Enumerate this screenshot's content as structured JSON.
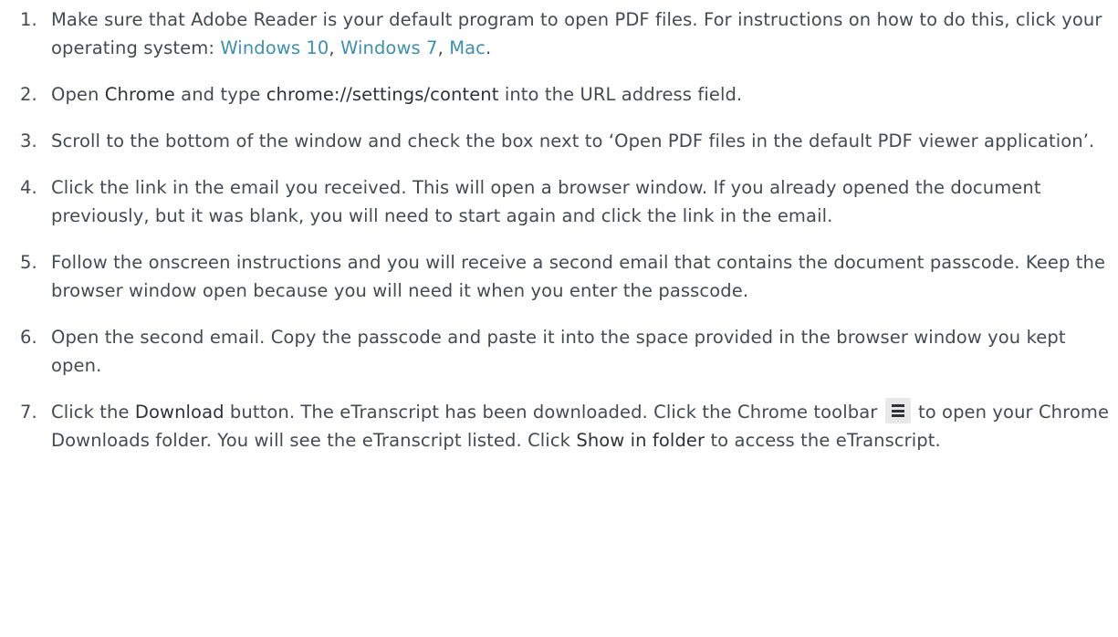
{
  "steps": [
    {
      "number": "1.",
      "t1": "Make sure that Adobe Reader is your default program to open PDF files. For instructions on how to do this, click your operating system: ",
      "link_win10": "Windows 10",
      "sep1": ", ",
      "link_win7": "Windows 7",
      "sep2": ", ",
      "link_mac": "Mac",
      "end": "."
    },
    {
      "number": "2.",
      "t1": "Open ",
      "b1": "Chrome",
      "t2": " and type ",
      "b2": "chrome://settings/content",
      "t3": " into the URL address field."
    },
    {
      "number": "3.",
      "text": "Scroll to the bottom of the window and check the box next to ‘Open PDF files in the default PDF viewer application’."
    },
    {
      "number": "4.",
      "text": "Click the link in the email you received. This will open a browser window. If you already opened the document previously, but it was blank, you will need to start again and click the link in the email."
    },
    {
      "number": "5.",
      "text": "Follow the onscreen instructions and you will receive a second email that contains the document passcode. Keep the browser window open because you will need it when you enter the passcode."
    },
    {
      "number": "6.",
      "text": "Open the second email. Copy the passcode and paste it into the space provided in the browser window you kept open."
    },
    {
      "number": "7.",
      "t1": "Click the ",
      "b1": "Download",
      "t2": " button. The eTranscript has been downloaded. Click the Chrome toolbar ",
      "icon": "hamburger-menu-icon",
      "t3": " to open your Chrome Downloads folder. You will see the eTranscript listed. Click ",
      "b2": "Show in folder",
      "t4": " to access the eTranscript."
    }
  ]
}
